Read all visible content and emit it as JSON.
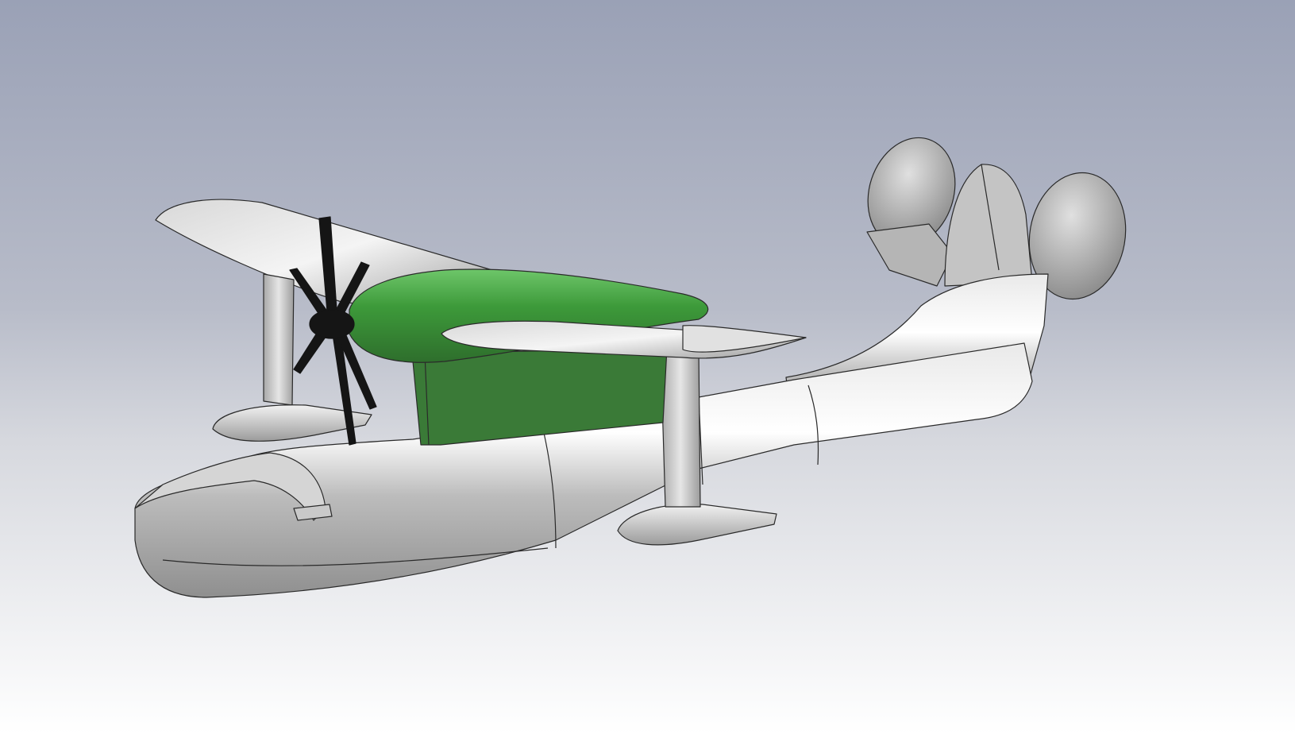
{
  "viewport": {
    "background_top": "#9aa1b6",
    "background_mid": "#d6d8de",
    "background_bottom": "#ffffff"
  },
  "model": {
    "metal_color": "#bdbdbd",
    "metal_highlight": "#f2f2f2",
    "metal_shadow": "#8c8c8c",
    "accent_green": "#3d9a3a",
    "accent_green_dark": "#2e6e2c",
    "propeller_color": "#151515",
    "edge_color": "#2a2a2a"
  }
}
